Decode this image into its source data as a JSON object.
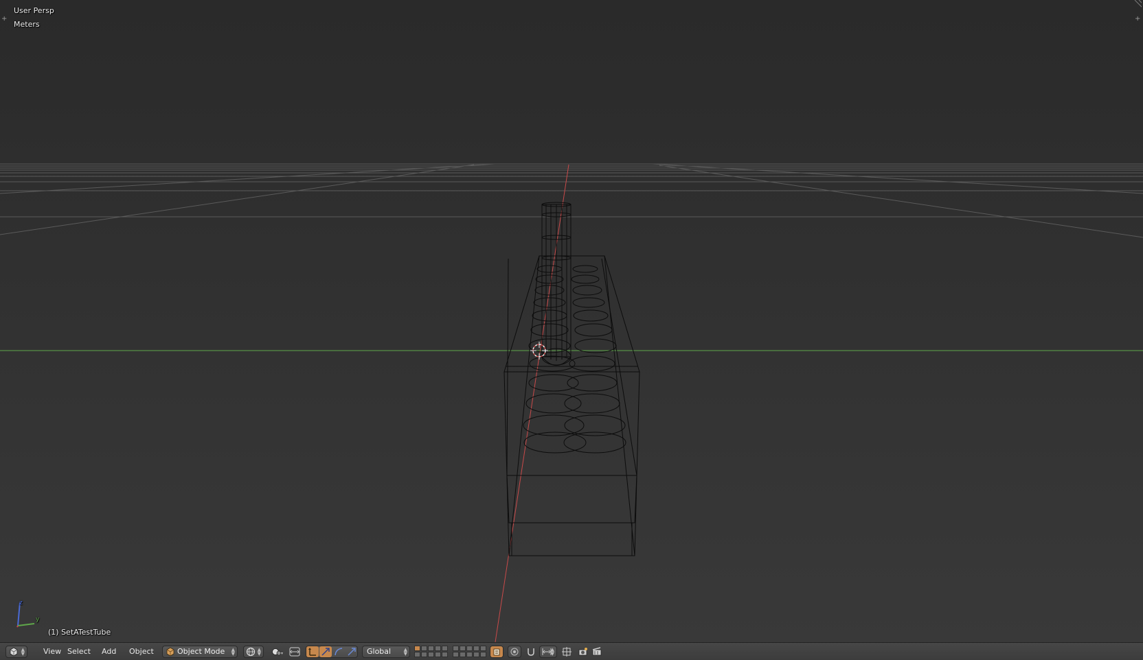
{
  "viewport": {
    "view_name": "User Persp",
    "units": "Meters",
    "object_info": "(1) SetATestTube",
    "axis_gizmo": {
      "y_label": "y",
      "z_label": "z"
    }
  },
  "header": {
    "editor_type_icon": "3d-view-icon",
    "menus": [
      {
        "label": "View"
      },
      {
        "label": "Select"
      },
      {
        "label": "Add"
      },
      {
        "label": "Object"
      }
    ],
    "mode": {
      "label": "Object Mode",
      "icon": "cube-icon"
    },
    "shading_icon": "sphere-shading-icon",
    "pivot_icon": "pivot-icon",
    "manipulator_icons": [
      "manipulator-toggle-icon",
      "translate-icon",
      "rotate-icon",
      "scale-icon"
    ],
    "orientation": {
      "label": "Global"
    },
    "layers_active_index": 0,
    "lock_icon": "lock-layers-icon",
    "proportional_icon": "proportional-edit-icon",
    "snap_icons": [
      "snap-icon",
      "snap-element-icon",
      "snap-target-icon"
    ],
    "render_icons": [
      "opengl-render-icon",
      "opengl-animation-icon"
    ]
  },
  "colors": {
    "x_axis": "#c94a4a",
    "y_axis": "#5fa84a",
    "active": "#c7884d",
    "wire": "#0c0c0c"
  }
}
